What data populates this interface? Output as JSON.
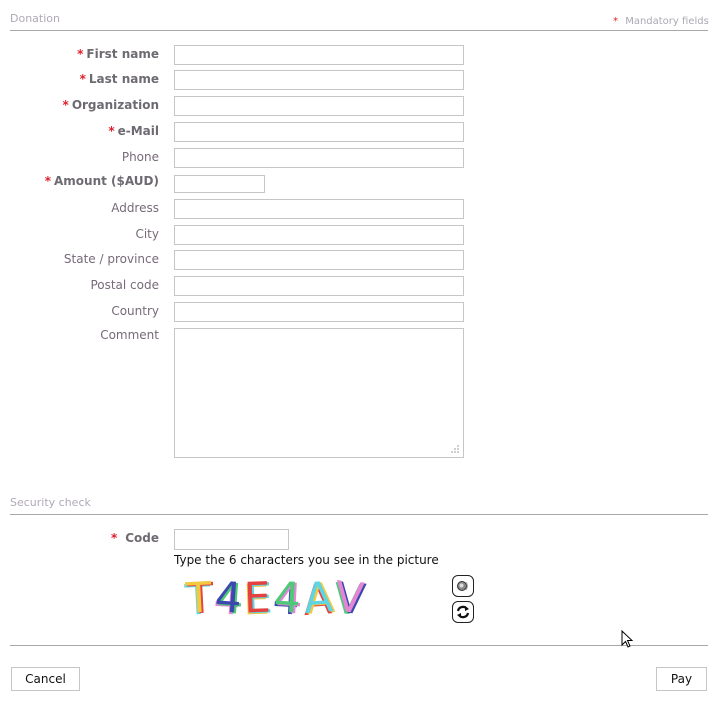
{
  "donation": {
    "section_title": "Donation",
    "mandatory_marker": "*",
    "mandatory_text": "Mandatory fields",
    "fields": [
      {
        "label": "First name",
        "required": true,
        "value": ""
      },
      {
        "label": "Last name",
        "required": true,
        "value": ""
      },
      {
        "label": "Organization",
        "required": true,
        "value": ""
      },
      {
        "label": "e-Mail",
        "required": true,
        "value": ""
      },
      {
        "label": "Phone",
        "required": false,
        "value": ""
      },
      {
        "label": "Amount ($AUD)",
        "required": true,
        "value": ""
      },
      {
        "label": "Address",
        "required": false,
        "value": ""
      },
      {
        "label": "City",
        "required": false,
        "value": ""
      },
      {
        "label": "State / province",
        "required": false,
        "value": ""
      },
      {
        "label": "Postal code",
        "required": false,
        "value": ""
      },
      {
        "label": "Country",
        "required": false,
        "value": ""
      },
      {
        "label": "Comment",
        "required": false,
        "value": ""
      }
    ]
  },
  "security": {
    "section_title": "Security check",
    "code_label": "Code",
    "code_value": "",
    "hint": "Type the 6 characters you see in the picture",
    "captcha_chars": [
      "T",
      "4",
      "E",
      "4",
      "A",
      "V"
    ],
    "captcha_colors": [
      "#f0c020",
      "#1a2aa0",
      "#e02020",
      "#30c060",
      "#40d0e0",
      "#e070d0"
    ],
    "audio_icon": "speaker-icon",
    "refresh_icon": "refresh-icon"
  },
  "actions": {
    "cancel_label": "Cancel",
    "pay_label": "Pay"
  }
}
